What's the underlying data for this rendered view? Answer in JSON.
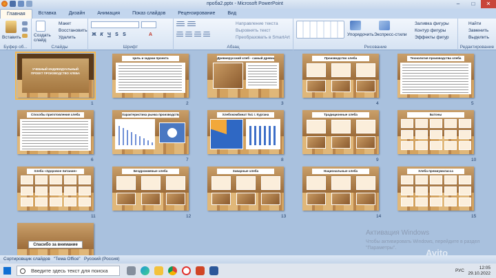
{
  "window": {
    "title": "пробa2.pptx - Microsoft PowerPoint"
  },
  "tabs": [
    "Главная",
    "Вставка",
    "Дизайн",
    "Анимация",
    "Показ слайдов",
    "Рецензирование",
    "Вид"
  ],
  "ribbon": {
    "clipboard": {
      "label": "Буфер об...",
      "paste": "Вставить"
    },
    "slides": {
      "label": "Слайды",
      "new_slide": "Создать слайд",
      "layout": "Макет",
      "reset": "Восстановить",
      "delete": "Удалить"
    },
    "font": {
      "label": "Шрифт"
    },
    "paragraph": {
      "label": "Абзац",
      "text_direction": "Направление текста",
      "align_text": "Выровнять текст",
      "smartart": "Преобразовать в SmartArt"
    },
    "drawing": {
      "label": "Рисование",
      "arrange": "Упорядочить",
      "quick_styles": "Экспресс-стили",
      "fill": "Заливка фигуры",
      "outline": "Контур фигуры",
      "effects": "Эффекты фигур"
    },
    "editing": {
      "label": "Редактирование",
      "find": "Найти",
      "replace": "Заменить",
      "select": "Выделить"
    }
  },
  "slides": [
    {
      "n": "1",
      "title": "УЧЕБНЫЙ ИНДИВИДУАЛЬНЫЙ ПРОЕКТ ПРОИЗВОДСТВО ХЛЕБА",
      "kind": "title"
    },
    {
      "n": "2",
      "title": "Цель и задачи проекта",
      "kind": "text"
    },
    {
      "n": "3",
      "title": "Древнерусский хлеб - самый древний на домашних де ныхлебов",
      "kind": "photo"
    },
    {
      "n": "4",
      "title": "Производство хлеба",
      "kind": "photos"
    },
    {
      "n": "5",
      "title": "Технология производства хлеба",
      "kind": "table"
    },
    {
      "n": "6",
      "title": "Способы приготовления хлеба",
      "kind": "table"
    },
    {
      "n": "7",
      "title": "Характеристика рынка производства хлеба в России",
      "kind": "chart"
    },
    {
      "n": "8",
      "title": "Хлебокомбинат №1 г. Кургана",
      "kind": "chart2"
    },
    {
      "n": "9",
      "title": "Традиционные хлеба",
      "kind": "photos"
    },
    {
      "n": "10",
      "title": "Батоны",
      "kind": "grid"
    },
    {
      "n": "11",
      "title": "Хлеба «Здоровое питание»",
      "kind": "grid"
    },
    {
      "n": "12",
      "title": "Бездрожжевые хлеба",
      "kind": "photos"
    },
    {
      "n": "13",
      "title": "Заварные хлеба",
      "kind": "photos"
    },
    {
      "n": "14",
      "title": "Национальные хлеба",
      "kind": "photos"
    },
    {
      "n": "15",
      "title": "Хлеба премиумкласса",
      "kind": "grid"
    },
    {
      "n": "16",
      "title": "Спасибо за внимание",
      "kind": "end"
    }
  ],
  "watermark": {
    "line1": "Активация Windows",
    "line2": "Чтобы активировать Windows, перейдите в раздел \"Параметры\"."
  },
  "avito": "Avito",
  "status": {
    "view": "Сортировщик слайдов",
    "theme": "\"Тема Office\"",
    "lang": "Русский (Россия)"
  },
  "taskbar": {
    "search": "Введите здесь текст для поиска",
    "lang": "РУС",
    "time": "12:05",
    "date": "29.10.2022"
  }
}
